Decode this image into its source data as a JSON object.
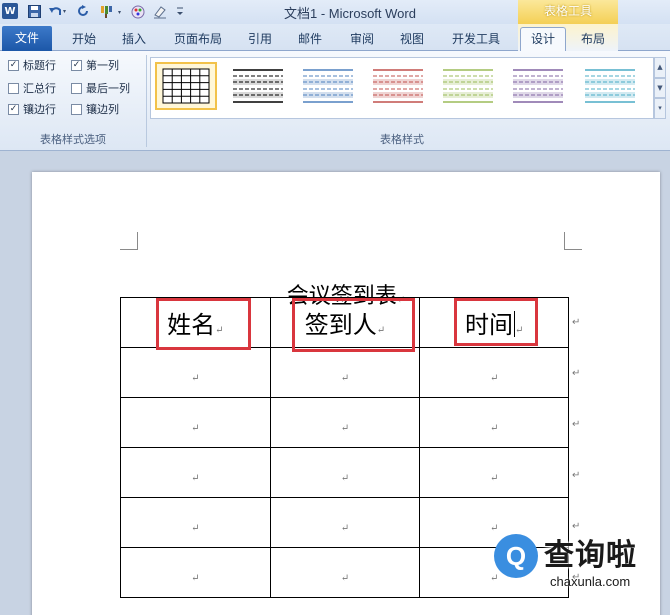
{
  "window": {
    "app_icon": "W",
    "title": "文档1 - Microsoft Word",
    "context_tab_group": "表格工具"
  },
  "quick_access": {
    "icons": [
      "save-icon",
      "undo-icon",
      "redo-icon",
      "format-painter-icon",
      "paint-icon",
      "eraser-icon",
      "customize-icon"
    ]
  },
  "tabs": {
    "file": "文件",
    "items": [
      {
        "label": "开始"
      },
      {
        "label": "插入"
      },
      {
        "label": "页面布局"
      },
      {
        "label": "引用"
      },
      {
        "label": "邮件"
      },
      {
        "label": "审阅"
      },
      {
        "label": "视图"
      },
      {
        "label": "开发工具"
      },
      {
        "label": "设计"
      },
      {
        "label": "布局"
      }
    ],
    "active": "设计"
  },
  "ribbon": {
    "style_options": {
      "label": "表格样式选项",
      "checkboxes": [
        {
          "label": "标题行",
          "checked": true
        },
        {
          "label": "第一列",
          "checked": true
        },
        {
          "label": "汇总行",
          "checked": false
        },
        {
          "label": "最后一列",
          "checked": false
        },
        {
          "label": "镶边行",
          "checked": true
        },
        {
          "label": "镶边列",
          "checked": false
        }
      ]
    },
    "table_styles": {
      "label": "表格样式",
      "styles": [
        {
          "name": "网格型",
          "color": "#000000",
          "selected": true
        },
        {
          "name": "浅色底纹",
          "color": "#000000",
          "selected": false
        },
        {
          "name": "浅色底纹 强调文字颜色1",
          "color": "#4f81bd",
          "selected": false
        },
        {
          "name": "浅色底纹 强调文字颜色2",
          "color": "#c0504d",
          "selected": false
        },
        {
          "name": "浅色底纹 强调文字颜色3",
          "color": "#9bbb59",
          "selected": false
        },
        {
          "name": "浅色底纹 强调文字颜色4",
          "color": "#8064a2",
          "selected": false
        },
        {
          "name": "浅色底纹 强调文字颜色5",
          "color": "#4bacc6",
          "selected": false
        }
      ]
    }
  },
  "document": {
    "heading": "会议签到表",
    "paragraph_mark": "↵",
    "table": {
      "header": [
        "姓名",
        "签到人",
        "时间"
      ],
      "empty_rows": 5
    }
  },
  "colors": {
    "highlight": "#d9363e",
    "file_tab": "#2b5797",
    "context_tab": "#f4cf55"
  },
  "watermark": {
    "logo_letter": "Q",
    "title": "查询啦",
    "subtitle": "chaxunla.com"
  }
}
